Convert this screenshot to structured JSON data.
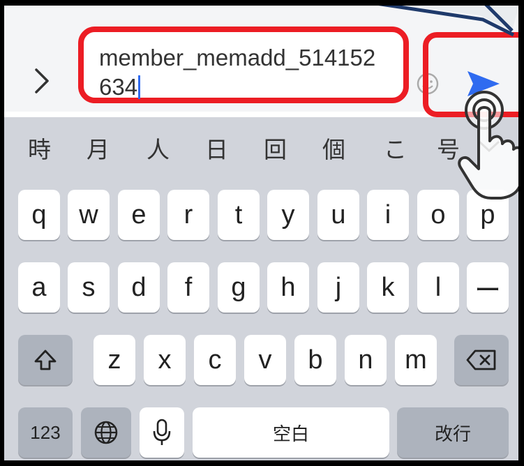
{
  "input": {
    "value": "member_memadd_514152634",
    "line1": "member_memadd_514152",
    "line2": "634"
  },
  "icons": {
    "expand": "chevron-right-icon",
    "emoji": "emoji-icon",
    "send": "send-icon",
    "hand": "tap-hand-icon"
  },
  "candidates": [
    "時",
    "月",
    "人",
    "日",
    "回",
    "個",
    "こ",
    "号"
  ],
  "keyboard": {
    "row1": [
      "q",
      "w",
      "e",
      "r",
      "t",
      "y",
      "u",
      "i",
      "o",
      "p"
    ],
    "row2": [
      "a",
      "s",
      "d",
      "f",
      "g",
      "h",
      "j",
      "k",
      "l",
      "ー"
    ],
    "row3": [
      "z",
      "x",
      "c",
      "v",
      "b",
      "n",
      "m"
    ],
    "numbers_label": "123",
    "space_label": "空白",
    "return_label": "改行"
  },
  "colors": {
    "highlight": "#ec1d24",
    "send": "#2f6bf0",
    "callout": "#1f3a6b",
    "keyboard_bg": "#d1d4db"
  }
}
